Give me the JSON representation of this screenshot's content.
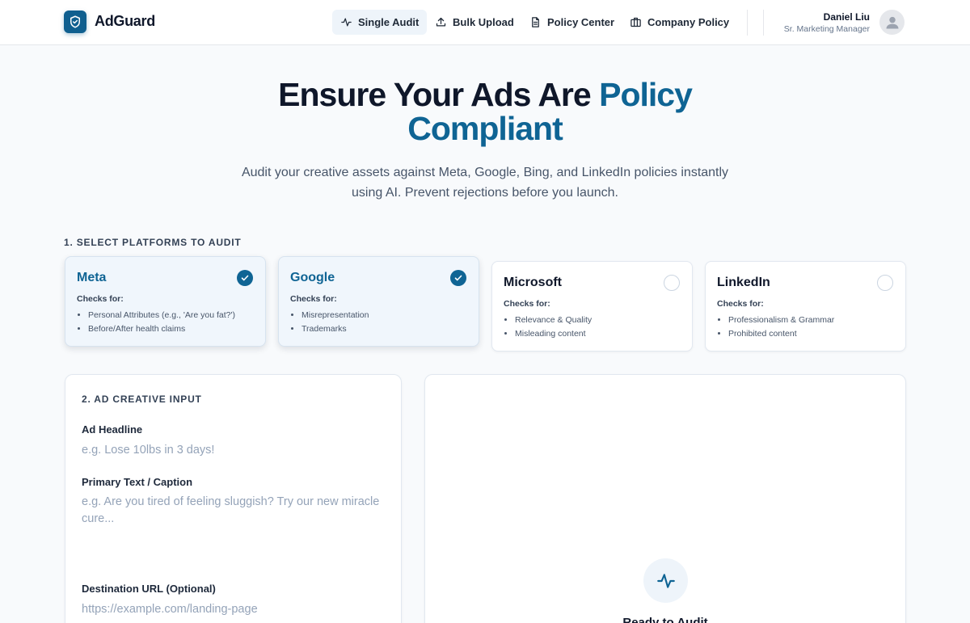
{
  "brand": {
    "name": "AdGuard"
  },
  "nav": {
    "items": [
      {
        "label": "Single Audit",
        "icon": "activity-icon",
        "active": true
      },
      {
        "label": "Bulk Upload",
        "icon": "upload-icon",
        "active": false
      },
      {
        "label": "Policy Center",
        "icon": "document-icon",
        "active": false
      },
      {
        "label": "Company Policy",
        "icon": "briefcase-icon",
        "active": false
      }
    ]
  },
  "user": {
    "name": "Daniel Liu",
    "role": "Sr. Marketing Manager"
  },
  "hero": {
    "title_part1": "Ensure Your Ads Are",
    "title_accent1": "Policy",
    "title_accent2": "Compliant",
    "subtitle": "Audit your creative assets against Meta, Google, Bing, and LinkedIn policies instantly using AI. Prevent rejections before you launch."
  },
  "platforms": {
    "section_label": "1. SELECT PLATFORMS TO AUDIT",
    "checks_title": "Checks for:",
    "items": [
      {
        "name": "Meta",
        "selected": true,
        "checks": [
          "Personal Attributes (e.g., 'Are you fat?')",
          "Before/After health claims"
        ]
      },
      {
        "name": "Google",
        "selected": true,
        "checks": [
          "Misrepresentation",
          "Trademarks"
        ]
      },
      {
        "name": "Microsoft",
        "selected": false,
        "checks": [
          "Relevance & Quality",
          "Misleading content"
        ]
      },
      {
        "name": "LinkedIn",
        "selected": false,
        "checks": [
          "Professionalism & Grammar",
          "Prohibited content"
        ]
      }
    ]
  },
  "creative": {
    "section_label": "2. AD CREATIVE INPUT",
    "headline_label": "Ad Headline",
    "headline_placeholder": "e.g. Lose 10lbs in 3 days!",
    "primary_label": "Primary Text / Caption",
    "primary_placeholder": "e.g. Are you tired of feeling sluggish? Try our new miracle cure...",
    "url_label": "Destination URL (Optional)",
    "url_placeholder": "https://example.com/landing-page"
  },
  "results": {
    "ready_text": "Ready to Audit",
    "icon": "activity-icon"
  },
  "colors": {
    "accent": "#0f6494",
    "active_nav_bg": "#eef4fa",
    "page_bg": "#f8fafc"
  }
}
